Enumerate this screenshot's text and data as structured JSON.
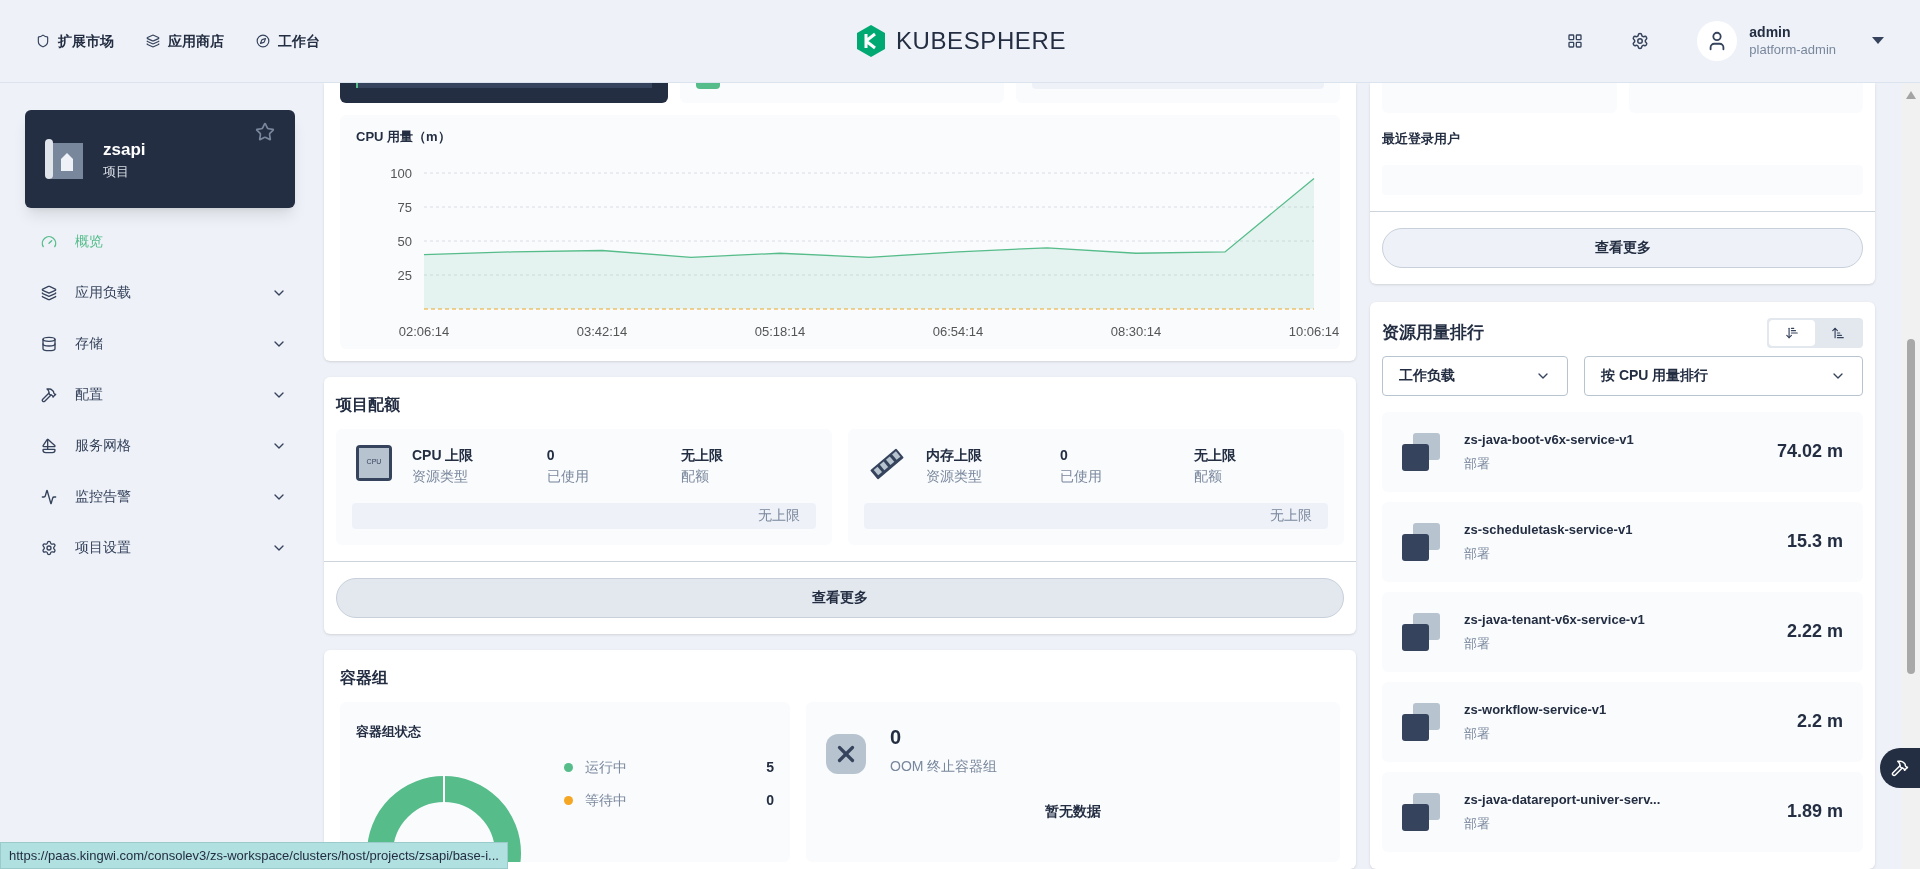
{
  "header": {
    "nav": [
      {
        "kind": "market",
        "label": "扩展市场"
      },
      {
        "kind": "store",
        "label": "应用商店"
      },
      {
        "kind": "workbench",
        "label": "工作台"
      }
    ],
    "logo_text": "KUBESPHERE",
    "user": {
      "name": "admin",
      "role": "platform-admin"
    }
  },
  "sidebar": {
    "project": {
      "name": "zsapi",
      "type": "项目",
      "starred": false
    },
    "menu": [
      {
        "kind": "overview",
        "label": "概览",
        "selected": true,
        "expandable": false
      },
      {
        "kind": "workload",
        "label": "应用负载",
        "selected": false,
        "expandable": true
      },
      {
        "kind": "storage",
        "label": "存储",
        "selected": false,
        "expandable": true
      },
      {
        "kind": "config",
        "label": "配置",
        "selected": false,
        "expandable": true
      },
      {
        "kind": "mesh",
        "label": "服务网格",
        "selected": false,
        "expandable": true
      },
      {
        "kind": "monitor",
        "label": "监控告警",
        "selected": false,
        "expandable": true
      },
      {
        "kind": "settings",
        "label": "项目设置",
        "selected": false,
        "expandable": true
      }
    ]
  },
  "cpu_chart": {
    "title": "CPU 用量（m）",
    "chart_data": {
      "type": "area",
      "categories": [
        "02:06:14",
        null,
        "03:42:14",
        null,
        "05:18:14",
        null,
        "06:54:14",
        null,
        "08:30:14",
        null,
        "10:06:14"
      ],
      "series": [
        {
          "color": "#55bc8a",
          "values": [
            40,
            42,
            43,
            38,
            41,
            38,
            42,
            45,
            41,
            42,
            96
          ]
        }
      ],
      "ylim": [
        0,
        100
      ],
      "yticks": [
        25,
        50,
        75,
        100
      ],
      "grid": true
    }
  },
  "quota": {
    "title": "项目配额",
    "items": [
      {
        "kind": "cpu",
        "icon_label": "CPU",
        "name": "CPU 上限",
        "name_sub": "资源类型",
        "used": "0",
        "used_sub": "已使用",
        "quota": "无上限",
        "quota_sub": "配额",
        "bar_label": "无上限"
      },
      {
        "kind": "memory",
        "name": "内存上限",
        "name_sub": "资源类型",
        "used": "0",
        "used_sub": "已使用",
        "quota": "无上限",
        "quota_sub": "配额",
        "bar_label": "无上限"
      }
    ],
    "more_button": "查看更多"
  },
  "pods": {
    "title": "容器组",
    "status_title": "容器组状态",
    "statuses": [
      {
        "label": "运行中",
        "count": "5",
        "color": "#55bc8a"
      },
      {
        "label": "等待中",
        "count": "0",
        "color": "#f5a623"
      }
    ],
    "oom": {
      "count": "0",
      "label": "OOM 终止容器组"
    },
    "empty_text": "暂无数据"
  },
  "right": {
    "recent_users": {
      "title": "最近登录用户"
    },
    "more_button": "查看更多",
    "ranking": {
      "title": "资源用量排行",
      "sort": [
        {
          "kind": "desc",
          "selected": true
        },
        {
          "kind": "asc",
          "selected": false
        }
      ],
      "filters": [
        {
          "value": "工作负载"
        },
        {
          "value": "按 CPU 用量排行"
        }
      ],
      "items": [
        {
          "name": "zs-java-boot-v6x-service-v1",
          "type": "部署",
          "value": "74.02 m"
        },
        {
          "name": "zs-scheduletask-service-v1",
          "type": "部署",
          "value": "15.3 m"
        },
        {
          "name": "zs-java-tenant-v6x-service-v1",
          "type": "部署",
          "value": "2.22 m"
        },
        {
          "name": "zs-workflow-service-v1",
          "type": "部署",
          "value": "2.2 m"
        },
        {
          "name": "zs-java-datareport-univer-serv...",
          "type": "部署",
          "value": "1.89 m"
        }
      ]
    }
  },
  "link_status": "https://paas.kingwi.com/consolev3/zs-workspace/clusters/host/projects/zsapi/base-i..."
}
